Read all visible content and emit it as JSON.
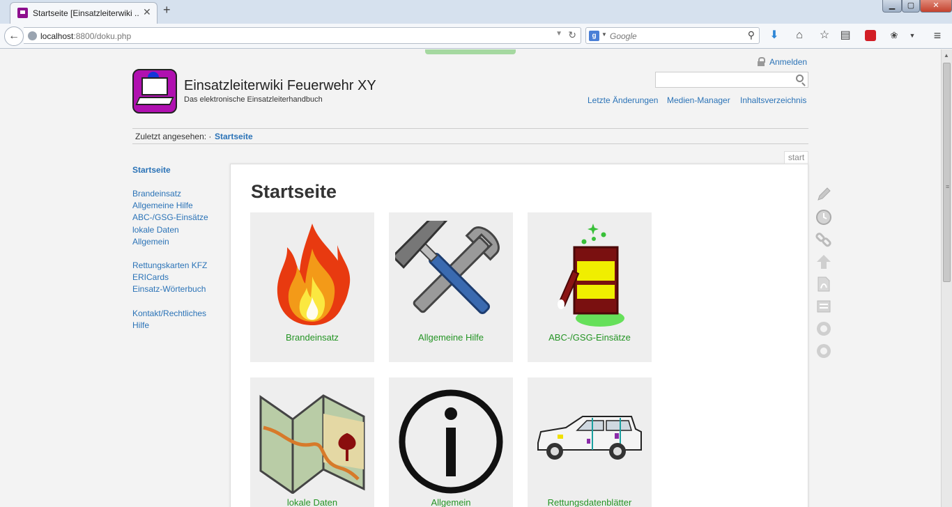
{
  "browser": {
    "tab_title": "Startseite [Einsatzleiterwiki ...",
    "tab_close": "✕",
    "new_tab": "+",
    "url_host": "localhost",
    "url_rest": ":8800/doku.php",
    "search_engine_placeholder": "Google",
    "window_buttons": {
      "minimize": "▁",
      "maximize": "▢",
      "close": "✕"
    }
  },
  "header": {
    "site_title": "Einsatzleiterwiki Feuerwehr XY",
    "tagline": "Das elektronische Einsatzleiterhandbuch",
    "login_label": "Anmelden",
    "search_value": "",
    "links": {
      "recent": "Letzte Änderungen",
      "media": "Medien-Manager",
      "index": "Inhaltsverzeichnis"
    }
  },
  "breadcrumbs": {
    "label": "Zuletzt angesehen: ·",
    "current": "Startseite"
  },
  "sidebar": {
    "items": [
      {
        "label": "Startseite"
      },
      {
        "label": "Brandeinsatz"
      },
      {
        "label": "Allgemeine Hilfe"
      },
      {
        "label": "ABC-/GSG-Einsätze"
      },
      {
        "label": "lokale Daten"
      },
      {
        "label": "Allgemein"
      },
      {
        "label": "Rettungskarten KFZ"
      },
      {
        "label": "ERICards"
      },
      {
        "label": "Einsatz-Wörterbuch"
      },
      {
        "label": "Kontakt/Rechtliches"
      },
      {
        "label": "Hilfe"
      }
    ]
  },
  "main": {
    "page_id": "start",
    "heading": "Startseite",
    "tiles": [
      {
        "label": "Brandeinsatz",
        "icon": "fire-icon"
      },
      {
        "label": "Allgemeine Hilfe",
        "icon": "tools-icon"
      },
      {
        "label": "ABC-/GSG-Einsätze",
        "icon": "hazard-barrel-icon"
      },
      {
        "label": "lokale Daten",
        "icon": "map-icon"
      },
      {
        "label": "Allgemein",
        "icon": "info-icon"
      },
      {
        "label": "Rettungsdatenblätter",
        "icon": "car-icon"
      }
    ]
  },
  "page_tools": [
    "edit-icon",
    "revisions-icon",
    "backlinks-icon",
    "back-to-top-icon",
    "pdf-export-icon",
    "odt-export-icon",
    "circle-icon",
    "circle-icon"
  ],
  "colors": {
    "link": "#2b73b7",
    "tile_label": "#249424",
    "logo": "#b010b0"
  }
}
